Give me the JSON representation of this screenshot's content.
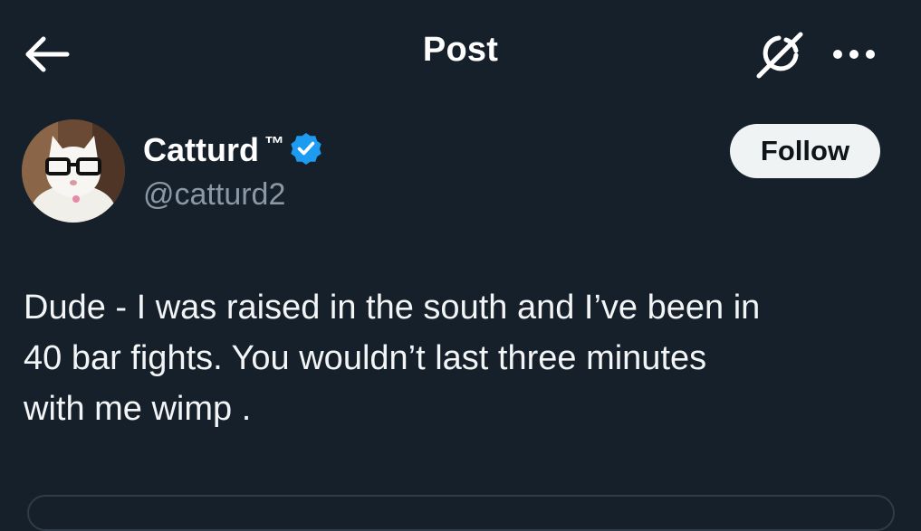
{
  "header": {
    "title": "Post",
    "back_icon": "arrow-left-icon",
    "grok_icon": "grok-slash-icon",
    "more_icon": "more-horizontal-icon"
  },
  "author": {
    "display_name": "Catturd",
    "trademark": "™",
    "handle": "@catturd2",
    "verified": true,
    "avatar": "white-cat-with-glasses-avatar"
  },
  "follow_button": {
    "label": "Follow"
  },
  "post": {
    "text": "Dude - I was raised in the south and I’ve been in\n40 bar fights. You wouldn’t last three minutes\nwith me wimp ."
  },
  "colors": {
    "background": "#15202b",
    "text": "#e7e9ea",
    "secondary_text": "#8b98a5",
    "verified_blue": "#1d9bf0",
    "button_bg": "#eff3f4"
  }
}
